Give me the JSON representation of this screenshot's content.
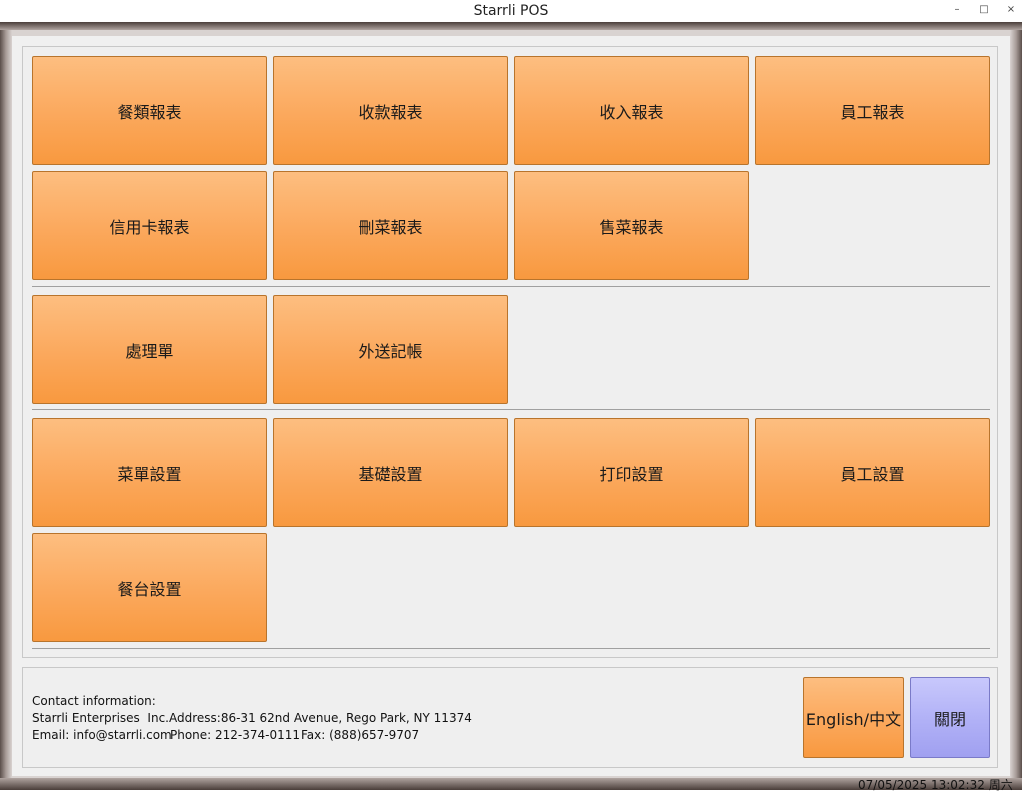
{
  "window": {
    "title": "Starrli POS",
    "minimize_icon": "minimize-icon",
    "maximize_icon": "maximize-icon",
    "close_icon": "close-icon"
  },
  "reports": [
    {
      "label": "餐類報表"
    },
    {
      "label": "收款報表"
    },
    {
      "label": "收入報表"
    },
    {
      "label": "員工報表"
    },
    {
      "label": "信用卡報表"
    },
    {
      "label": "刪菜報表"
    },
    {
      "label": "售菜報表"
    }
  ],
  "operations": [
    {
      "label": "處理單"
    },
    {
      "label": "外送記帳"
    }
  ],
  "settings": [
    {
      "label": "菜單設置"
    },
    {
      "label": "基礎設置"
    },
    {
      "label": "打印設置"
    },
    {
      "label": "員工設置"
    },
    {
      "label": "餐台設置"
    }
  ],
  "footer": {
    "contact_heading": "Contact information:",
    "company": "Starrli Enterprises  Inc.",
    "address": "Address:86-31 62nd Avenue, Rego Park, NY 11374",
    "email": "Email: info@starrli.com",
    "phone": "Phone: 212-374-0111",
    "fax": "Fax: (888)657-9707",
    "language_button": "English/中文",
    "close_button": "關閉"
  },
  "status": {
    "datetime": "07/05/2025 13:02:32 周六"
  },
  "colors": {
    "button_orange": "#fba85c",
    "button_blue": "#b0b0f6"
  }
}
